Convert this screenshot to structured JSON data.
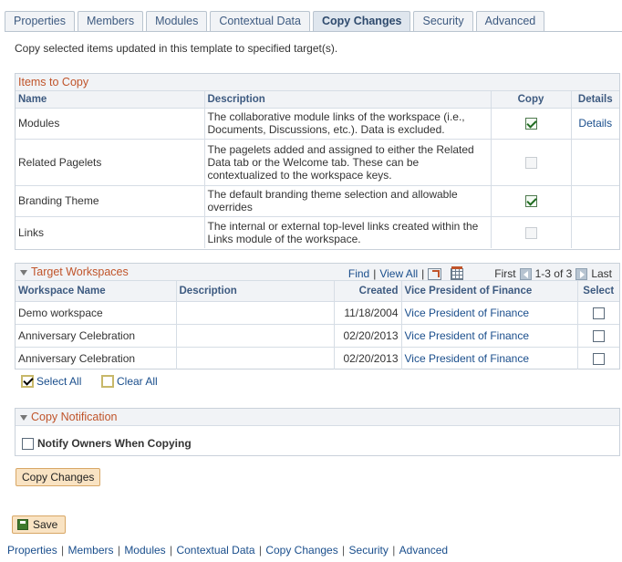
{
  "tabs": [
    "Properties",
    "Members",
    "Modules",
    "Contextual Data",
    "Copy Changes",
    "Security",
    "Advanced"
  ],
  "active_tab": "Copy Changes",
  "intro": "Copy selected items updated in this template to specified target(s).",
  "items_to_copy": {
    "title": "Items to Copy",
    "headers": {
      "name": "Name",
      "description": "Description",
      "copy": "Copy",
      "details": "Details"
    },
    "rows": [
      {
        "name": "Modules",
        "description": "The collaborative module links of the workspace (i.e., Documents, Discussions, etc.).  Data is excluded.",
        "copy": "checked",
        "details": "Details"
      },
      {
        "name": "Related Pagelets",
        "description": "The pagelets added and assigned to either the Related Data tab or the Welcome tab.  These can be contextualized to the workspace keys.",
        "copy": "disabled",
        "details": ""
      },
      {
        "name": "Branding Theme",
        "description": "The default branding theme selection and allowable overrides",
        "copy": "checked",
        "details": ""
      },
      {
        "name": "Links",
        "description": "The internal or external top-level links created within the Links module of the workspace.",
        "copy": "disabled",
        "details": ""
      }
    ]
  },
  "target_workspaces": {
    "title": "Target Workspaces",
    "nav": {
      "find": "Find",
      "separator": "|",
      "view_all": "View All",
      "first": "First",
      "range": "1-3 of 3",
      "last": "Last"
    },
    "headers": {
      "name": "Workspace Name",
      "description": "Description",
      "created": "Created",
      "owner": "Vice President of Finance",
      "select": "Select"
    },
    "rows": [
      {
        "name": "Demo workspace",
        "description": "",
        "created": "11/18/2004",
        "owner": "Vice President of Finance"
      },
      {
        "name": "Anniversary Celebration",
        "description": "",
        "created": "02/20/2013",
        "owner": "Vice President of Finance"
      },
      {
        "name": "Anniversary Celebration",
        "description": "",
        "created": "02/20/2013",
        "owner": "Vice President of Finance"
      }
    ]
  },
  "select_all": "Select All",
  "clear_all": "Clear All",
  "copy_notification": {
    "title": "Copy Notification",
    "notify_label": "Notify Owners When Copying"
  },
  "copy_changes_button": "Copy Changes",
  "save_button": "Save",
  "bottom_links": [
    "Properties",
    "Members",
    "Modules",
    "Contextual Data",
    "Copy Changes",
    "Security",
    "Advanced"
  ]
}
